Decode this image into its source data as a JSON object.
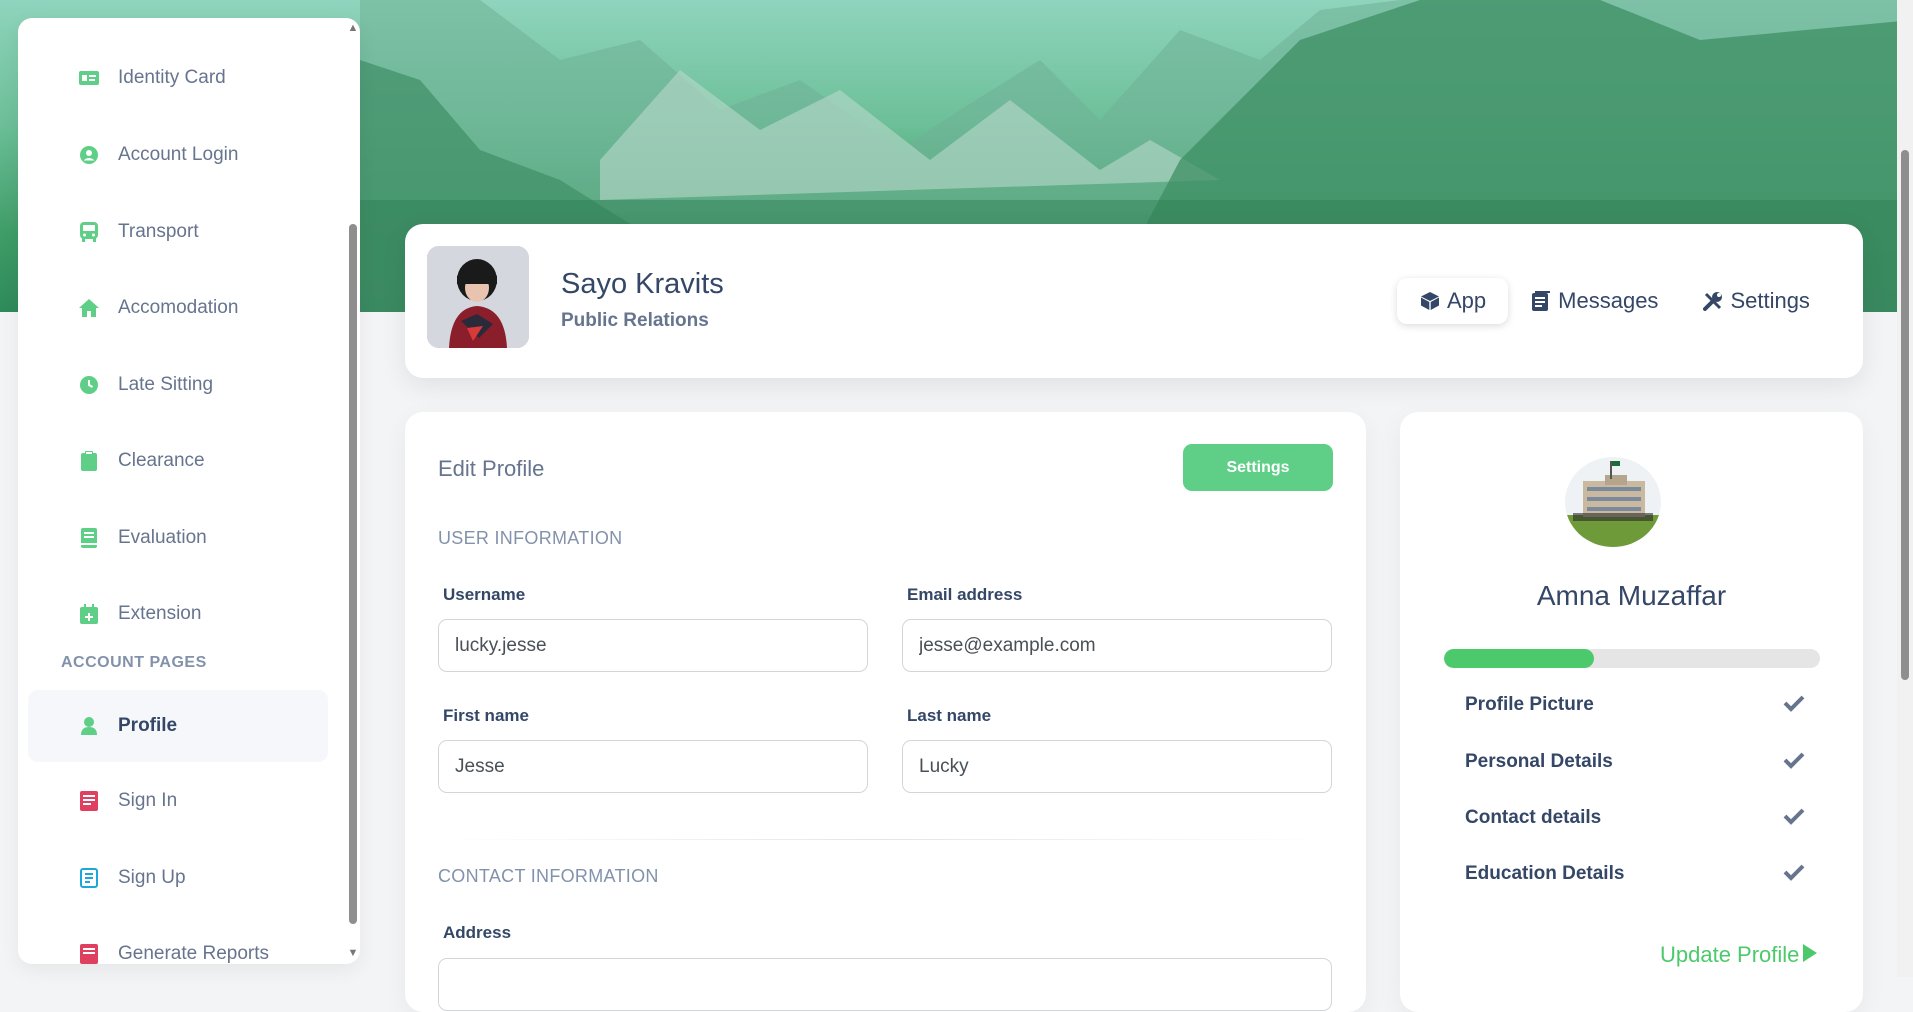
{
  "sidebar": {
    "items": [
      {
        "label": "Identity Card",
        "icon": "id-card-icon"
      },
      {
        "label": "Account Login",
        "icon": "user-circle-icon"
      },
      {
        "label": "Transport",
        "icon": "bus-icon"
      },
      {
        "label": "Accomodation",
        "icon": "home-icon"
      },
      {
        "label": "Late Sitting",
        "icon": "clock-icon"
      },
      {
        "label": "Clearance",
        "icon": "clipboard-icon"
      },
      {
        "label": "Evaluation",
        "icon": "book-icon"
      },
      {
        "label": "Extension",
        "icon": "calendar-plus-icon"
      }
    ],
    "section_label": "ACCOUNT PAGES",
    "account_items": [
      {
        "label": "Profile",
        "icon": "user-icon",
        "active": true
      },
      {
        "label": "Sign In",
        "icon": "document-icon"
      },
      {
        "label": "Sign Up",
        "icon": "signup-icon"
      },
      {
        "label": "Generate Reports",
        "icon": "report-icon"
      }
    ]
  },
  "profile": {
    "name": "Sayo Kravits",
    "role": "Public Relations",
    "tabs": [
      {
        "label": "App",
        "icon": "cube-icon",
        "active": true
      },
      {
        "label": "Messages",
        "icon": "messages-icon"
      },
      {
        "label": "Settings",
        "icon": "wrench-icon"
      }
    ]
  },
  "edit_profile": {
    "title": "Edit Profile",
    "settings_button": "Settings",
    "user_info_heading": "USER INFORMATION",
    "username_label": "Username",
    "username_value": "lucky.jesse",
    "email_label": "Email address",
    "email_value": "jesse@example.com",
    "first_name_label": "First name",
    "first_name_value": "Jesse",
    "last_name_label": "Last name",
    "last_name_value": "Lucky",
    "contact_heading": "CONTACT INFORMATION",
    "address_label": "Address"
  },
  "completion": {
    "name": "Amna Muzaffar",
    "progress_fraction": 0.4,
    "items": [
      {
        "label": "Profile Picture"
      },
      {
        "label": "Personal Details"
      },
      {
        "label": "Contact details"
      },
      {
        "label": "Education Details"
      }
    ],
    "update_link": "Update Profile"
  },
  "colors": {
    "accent": "#5fcf88",
    "progress": "#4cca6b",
    "text_dark": "#344767",
    "text_muted": "#67748e"
  }
}
